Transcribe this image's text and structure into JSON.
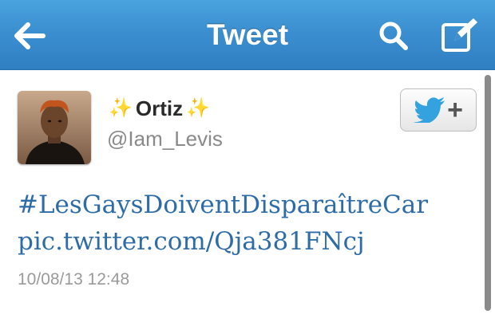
{
  "navbar": {
    "title": "Tweet",
    "back_icon": "arrow-left-icon",
    "search_icon": "search-icon",
    "compose_icon": "compose-icon",
    "background": "#3b8fd0"
  },
  "tweet": {
    "author": {
      "display_name": "Ortiz",
      "name_decoration": "✨",
      "handle": "@Iam_Levis",
      "avatar_icon": "avatar-photo"
    },
    "follow_button": {
      "icon": "twitter-bird-icon",
      "plus": "+"
    },
    "lines": [
      "#LesGaysDoiventDisparaîtreCar",
      "pic.twitter.com/Qja381FNcj"
    ],
    "timestamp": "10/08/13 12:48"
  },
  "colors": {
    "link": "#2e6ca8",
    "handle": "#8a8a8a",
    "timestamp": "#9a9a9a",
    "twitter_blue": "#35a2e0"
  }
}
